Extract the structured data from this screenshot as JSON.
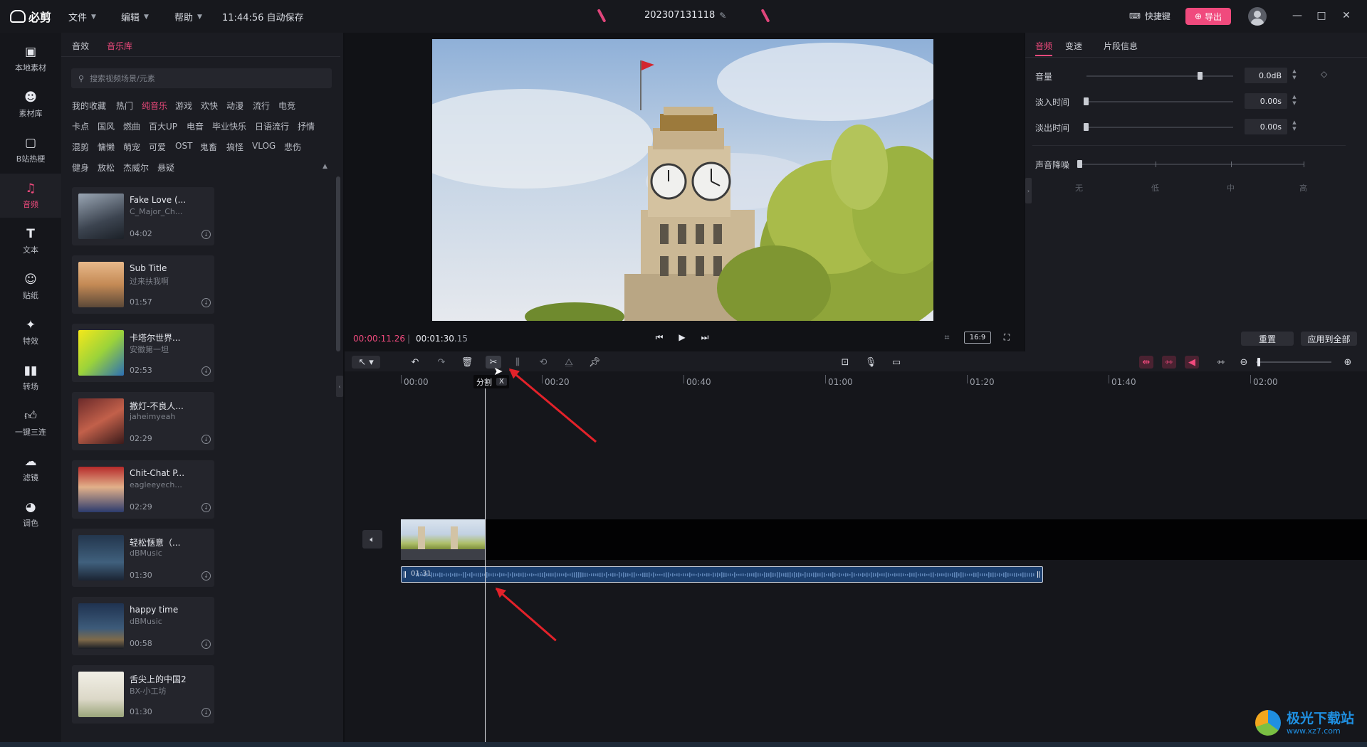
{
  "titlebar": {
    "app_name": "必剪",
    "menus": [
      {
        "label": "文件"
      },
      {
        "label": "编辑"
      },
      {
        "label": "帮助"
      }
    ],
    "autosave": "11:44:56 自动保存",
    "project_name": "202307131118",
    "shortcut_label": "快捷键",
    "export_label": "导出",
    "window_controls": [
      "—",
      "□",
      "✕"
    ]
  },
  "rail": [
    {
      "label": "本地素材",
      "icon": "folder-icon"
    },
    {
      "label": "素材库",
      "icon": "mascot-icon"
    },
    {
      "label": "B站热梗",
      "icon": "tv-icon"
    },
    {
      "label": "音频",
      "icon": "music-note-icon",
      "active": true
    },
    {
      "label": "文本",
      "icon": "text-icon"
    },
    {
      "label": "贴纸",
      "icon": "sticker-icon"
    },
    {
      "label": "特效",
      "icon": "effects-icon"
    },
    {
      "label": "转场",
      "icon": "transition-icon"
    },
    {
      "label": "一键三连",
      "icon": "thumbs-up-icon"
    },
    {
      "label": "滤镜",
      "icon": "filter-icon"
    },
    {
      "label": "调色",
      "icon": "palette-icon"
    }
  ],
  "music_panel": {
    "tabs": [
      "音效",
      "音乐库"
    ],
    "active_tab": "音乐库",
    "search_placeholder": "搜索视频场景/元素",
    "tag_rows": [
      [
        "我的收藏",
        "热门",
        "纯音乐",
        "游戏",
        "欢快",
        "动漫",
        "流行",
        "电竞"
      ],
      [
        "卡点",
        "国风",
        "燃曲",
        "百大UP",
        "电音",
        "毕业快乐",
        "日语流行",
        "抒情"
      ],
      [
        "混剪",
        "慵懒",
        "萌宠",
        "可爱",
        "OST",
        "鬼畜",
        "搞怪",
        "VLOG",
        "悲伤"
      ],
      [
        "健身",
        "放松",
        "杰威尔",
        "悬疑"
      ]
    ],
    "active_tag": "纯音乐",
    "tracks": [
      {
        "title": "Fake Love (...",
        "artist": "C_Major_Ch...",
        "duration": "04:02"
      },
      {
        "title": "Sub Title",
        "artist": "过来扶我啊",
        "duration": "01:57"
      },
      {
        "title": "卡塔尔世界...",
        "artist": "安徽第一坦",
        "duration": "02:53"
      },
      {
        "title": "撤灯-不良人...",
        "artist": "jaheimyeah",
        "duration": "02:29"
      },
      {
        "title": "Chit-Chat P...",
        "artist": "eagleeyech...",
        "duration": "02:29"
      },
      {
        "title": "轻松惬意（...",
        "artist": "dBMusic",
        "duration": "01:30"
      },
      {
        "title": "happy time",
        "artist": "dBMusic",
        "duration": "00:58"
      },
      {
        "title": "舌尖上的中国2",
        "artist": "BX-小工坊",
        "duration": "01:30"
      }
    ]
  },
  "preview": {
    "current_time": "00:00:11.26",
    "total_time": "00:01:30",
    "total_frames": ".15",
    "aspect_ratio": "16:9"
  },
  "properties": {
    "tabs": [
      "音频",
      "变速",
      "片段信息"
    ],
    "active_tab": "音频",
    "volume_label": "音量",
    "volume_value": "0.0dB",
    "volume_level": 0.77,
    "fade_in_label": "淡入时间",
    "fade_in_value": "0.00s",
    "fade_out_label": "淡出时间",
    "fade_out_value": "0.00s",
    "noise_label": "声音降噪",
    "noise_levels": [
      "无",
      "低",
      "中",
      "高"
    ],
    "reset_label": "重置",
    "apply_all_label": "应用到全部"
  },
  "timeline": {
    "ruler": [
      "00:00",
      "00:20",
      "00:40",
      "01:00",
      "01:20",
      "01:40",
      "02:00"
    ],
    "tooltip_label": "分割",
    "tooltip_key": "X",
    "audio_clip_label": "01:31"
  },
  "watermark": {
    "name": "极光下载站",
    "url": "www.xz7.com"
  },
  "colors": {
    "accent": "#f04a7d",
    "annotation": "#e3222a",
    "audio_clip": "#1c3f6e"
  }
}
